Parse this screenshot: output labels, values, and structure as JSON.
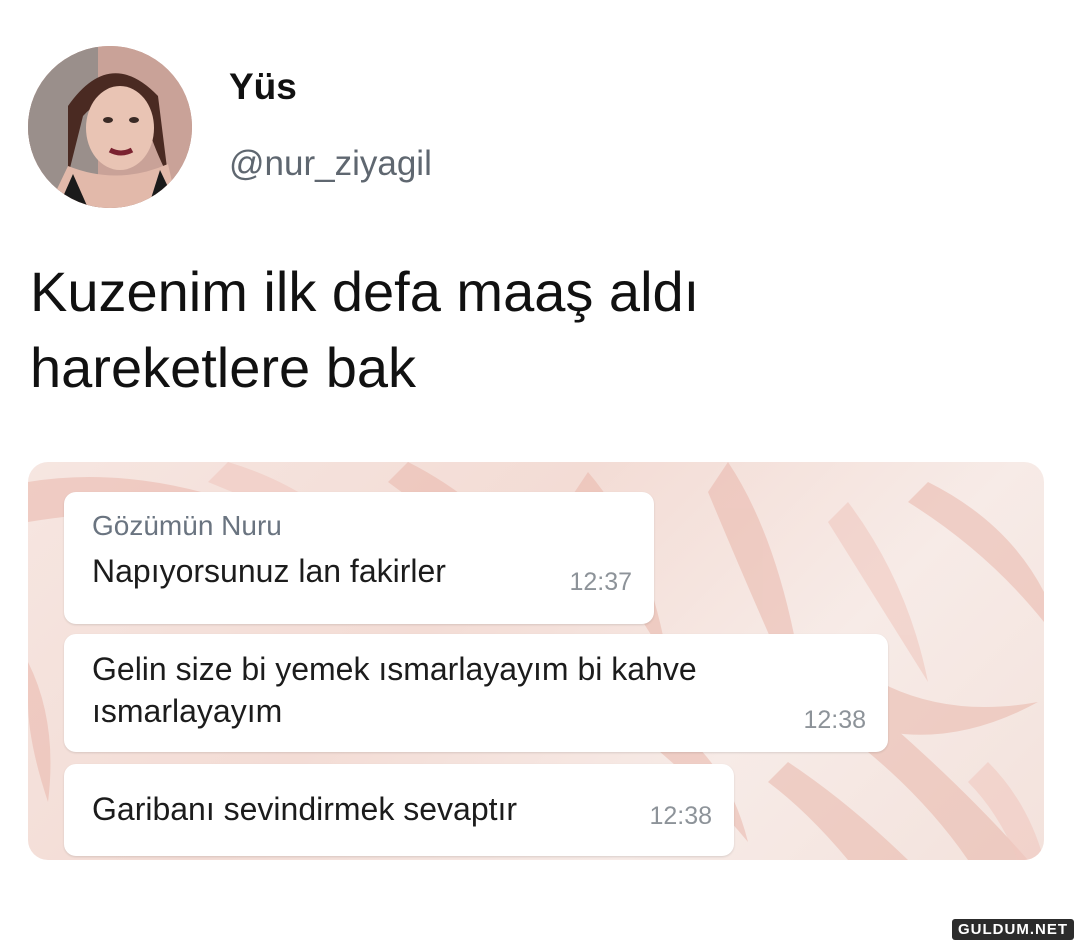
{
  "tweet": {
    "display_name": "Yüs",
    "handle": "@nur_ziyagil",
    "avatar_icon": "profile-photo",
    "text_lines": [
      "Kuzenim ilk defa maaş aldı",
      "hareketlere bak"
    ]
  },
  "chat": {
    "background_color": "#f3dcd5",
    "messages": [
      {
        "sender": "Gözümün Nuru",
        "text": "Napıyorsunuz lan fakirler",
        "time": "12:37"
      },
      {
        "sender": "",
        "text": "Gelin size bi yemek ısmarlayayım bi kahve ısmarlayayım",
        "time": "12:38"
      },
      {
        "sender": "",
        "text": "Garibanı sevindirmek sevaptır",
        "time": "12:38"
      }
    ]
  },
  "watermark": "GULDUM.NET"
}
